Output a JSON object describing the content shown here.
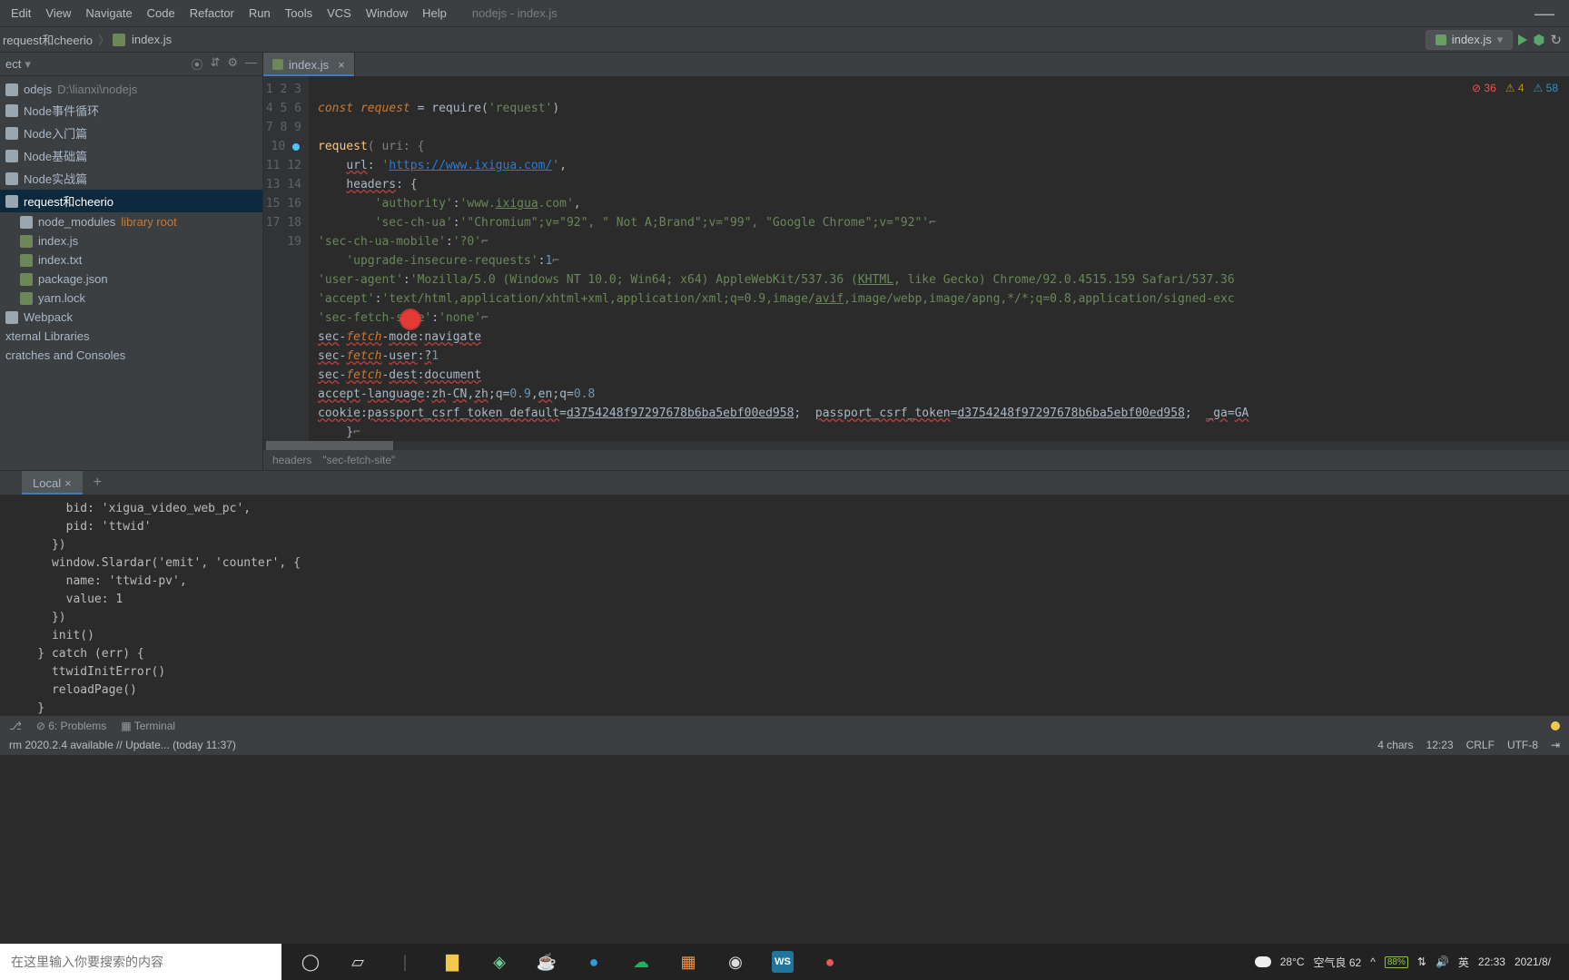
{
  "window": {
    "title": "nodejs - index.js"
  },
  "menu": [
    "Edit",
    "View",
    "Navigate",
    "Code",
    "Refactor",
    "Run",
    "Tools",
    "VCS",
    "Window",
    "Help"
  ],
  "breadcrumb": {
    "parts": [
      "request和cheerio",
      "index.js"
    ]
  },
  "runconfig": {
    "label": "index.js"
  },
  "toolbox_label": "ect",
  "tree": {
    "root": "odejs",
    "root_path": "D:\\lianxi\\nodejs",
    "items": [
      "Node事件循环",
      "Node入门篇",
      "Node基础篇",
      "Node实战篇",
      "request和cheerio"
    ],
    "sub": [
      {
        "label": "node_modules",
        "suffix": "library root"
      },
      {
        "label": "index.js"
      },
      {
        "label": "index.txt"
      },
      {
        "label": "package.json"
      },
      {
        "label": "yarn.lock"
      }
    ],
    "extras": [
      "Webpack",
      "xternal Libraries",
      "cratches and Consoles"
    ]
  },
  "tabs": [
    {
      "label": "index.js"
    }
  ],
  "indicators": {
    "errors": "36",
    "warns": "4",
    "weak": "58"
  },
  "code": {
    "l1": {
      "kw": "const ",
      "var": "request",
      "rest": " = require(",
      "str": "'request'",
      "end": ")"
    },
    "l3": {
      "fn": "request",
      "sig": "( uri: {"
    },
    "l4": {
      "key": "url",
      "url": "https://www.ixigua.com/"
    },
    "l5": {
      "key": "headers"
    },
    "l6": {
      "k": "'authority'",
      "v": "'www.",
      "u": "ixigua",
      "v2": ".com'"
    },
    "l7": {
      "k": "'sec-ch-ua'",
      "v": "'\"Chromium\";v=\"92\", \" Not A;Brand\";v=\"99\", \"Google Chrome\";v=\"92\"'"
    },
    "l8": {
      "k": "'sec-ch-ua-mobile'",
      "v": "'?0'"
    },
    "l9": {
      "k": "'upgrade-insecure-requests'",
      "v": "1"
    },
    "l10": {
      "k": "'user-agent'",
      "v": "'Mozilla/5.0 (Windows NT 10.0; Win64; x64) AppleWebKit/537.36 (",
      "u": "KHTML",
      "v2": ", like Gecko) Chrome/92.0.4515.159 Safari/537.36"
    },
    "l11": {
      "k": "'accept'",
      "v": "'text/html,application/xhtml+xml,application/xml;q=0.9,image/",
      "u": "avif",
      "v2": ",image/webp,image/apng,*/*;q=0.8,application/signed-exc"
    },
    "l12": {
      "k": "'sec-fetch-site'",
      "v": "'none'"
    },
    "l13": {
      "a": "sec",
      "b": "fetch",
      "c": "mode",
      "d": "navigate"
    },
    "l14": {
      "a": "sec",
      "b": "fetch",
      "c": "user",
      "d": "?1"
    },
    "l15": {
      "a": "sec",
      "b": "fetch",
      "c": "dest",
      "d": "document"
    },
    "l16": {
      "a": "accept",
      "b": "language",
      "zh": "zh",
      "cn": "CN",
      "zh2": "zh",
      "q": ";q=",
      "n1": "0.9",
      "en": "en",
      "n2": "0.8"
    },
    "l17": {
      "a": "cookie",
      "tok": "passport_csrf_token_default",
      "hash": "d3754248f97297678b6ba5ebf00ed958",
      "tok2": "passport_csrf_token",
      "ga": "_ga",
      "gav": "GA"
    }
  },
  "crumbs": [
    "headers",
    "\"sec-fetch-site\""
  ],
  "terminal": {
    "tab": "Local",
    "lines": [
      "        bid: 'xigua_video_web_pc',",
      "        pid: 'ttwid'",
      "      })",
      "      window.Slardar('emit', 'counter', {",
      "        name: 'ttwid-pv',",
      "        value: 1",
      "      })",
      "      init()",
      "    } catch (err) {",
      "      ttwidInitError()",
      "      reloadPage()",
      "    }"
    ]
  },
  "foot_tools": {
    "problems": "6: Problems",
    "terminal": "Terminal"
  },
  "foot_msg": "rm 2020.2.4 available // Update... (today 11:37)",
  "status": {
    "chars": "4 chars",
    "pos": "12:23",
    "sep": "CRLF",
    "enc": "UTF-8",
    "ind": ""
  },
  "search_placeholder": "在这里输入你要搜索的内容",
  "sys": {
    "temp": "28°C",
    "air": "空气良 62",
    "batt": "88%",
    "ime": "英",
    "time": "22:33",
    "date": "2021/8/"
  }
}
